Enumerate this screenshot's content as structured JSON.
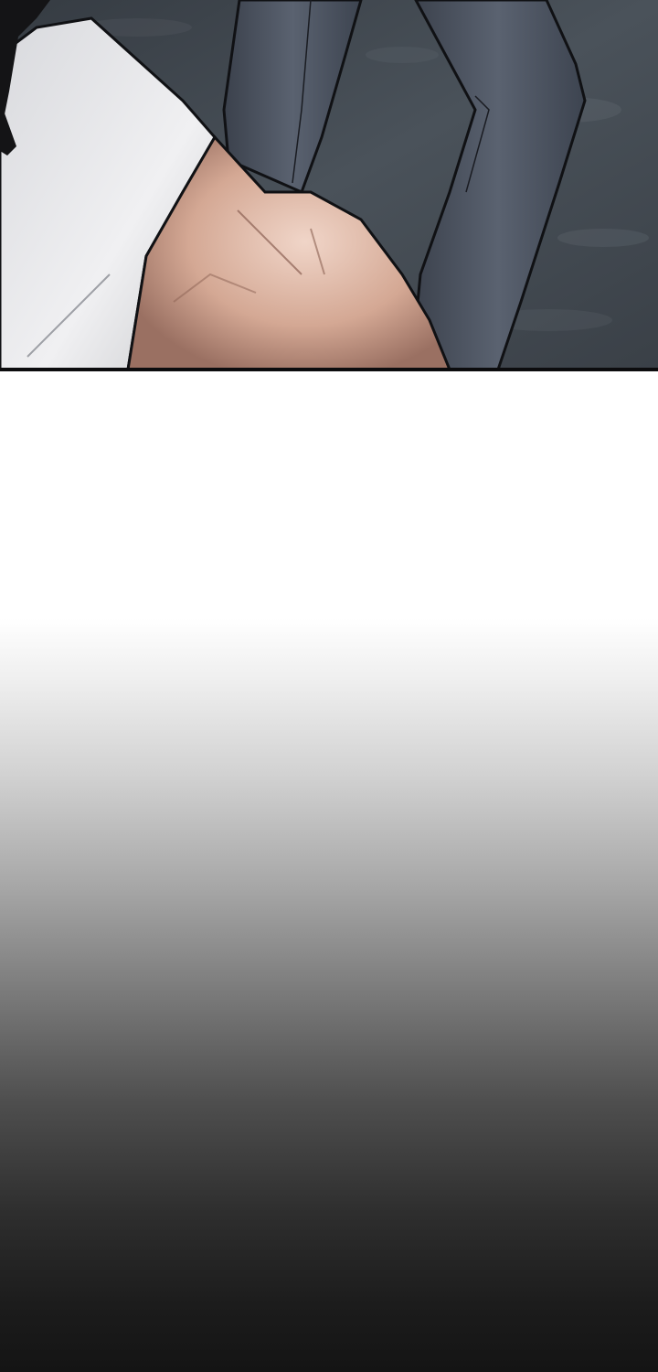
{
  "panel": {
    "scene": "comic-panel",
    "colors": {
      "ground": "#3d444c",
      "shirt": "#e6e7ea",
      "skin": "#d9b2a2",
      "pants": "#4a5260",
      "hair": "#141416",
      "ink": "#101114"
    }
  },
  "gutter": {
    "fade_from": "#ffffff",
    "fade_to": "#141414"
  }
}
